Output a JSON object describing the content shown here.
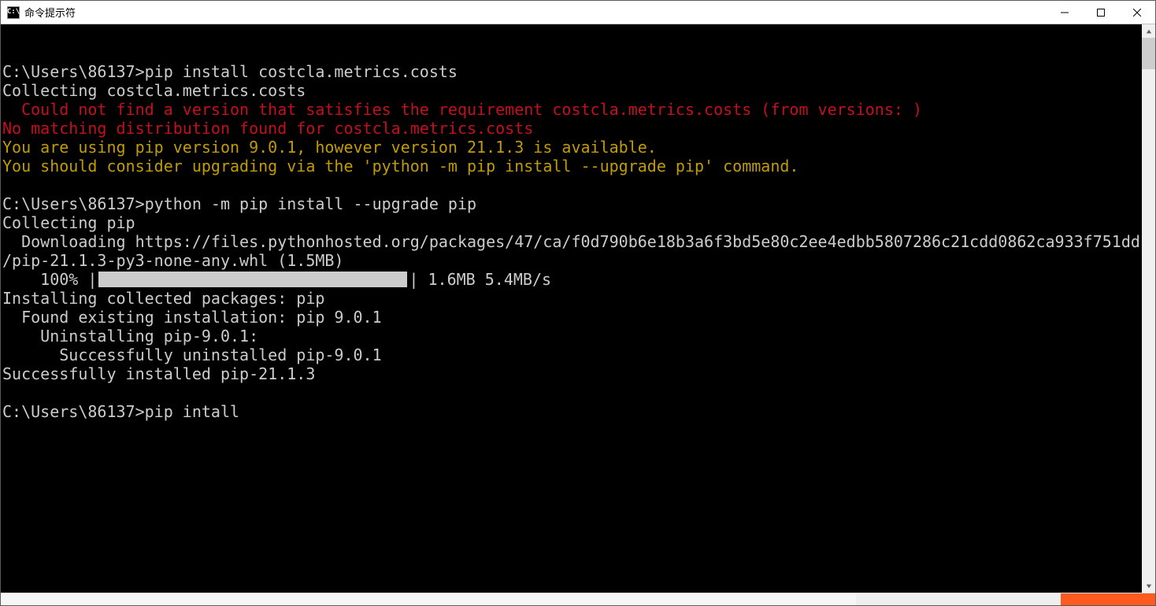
{
  "window": {
    "icon_text": "C:\\",
    "title": "命令提示符"
  },
  "terminal": {
    "blank_top": "",
    "prompt1": "C:\\Users\\86137>pip install costcla.metrics.costs",
    "collecting1": "Collecting costcla.metrics.costs",
    "err1": "  Could not find a version that satisfies the requirement costcla.metrics.costs (from versions: )",
    "err2": "No matching distribution found for costcla.metrics.costs",
    "warn1": "You are using pip version 9.0.1, however version 21.1.3 is available.",
    "warn2": "You should consider upgrading via the 'python -m pip install --upgrade pip' command.",
    "blank1": "",
    "prompt2": "C:\\Users\\86137>python -m pip install --upgrade pip",
    "collecting2": "Collecting pip",
    "download1": "  Downloading https://files.pythonhosted.org/packages/47/ca/f0d790b6e18b3a6f3bd5e80c2ee4edbb5807286c21cdd0862ca933f751dd",
    "download2": "/pip-21.1.3-py3-none-any.whl (1.5MB)",
    "progress_pct": "    100% |",
    "progress_tail": "| 1.6MB 5.4MB/s",
    "install1": "Installing collected packages: pip",
    "install2": "  Found existing installation: pip 9.0.1",
    "install3": "    Uninstalling pip-9.0.1:",
    "install4": "      Successfully uninstalled pip-9.0.1",
    "install5": "Successfully installed pip-21.1.3",
    "blank2": "",
    "prompt3": "C:\\Users\\86137>pip intall"
  }
}
